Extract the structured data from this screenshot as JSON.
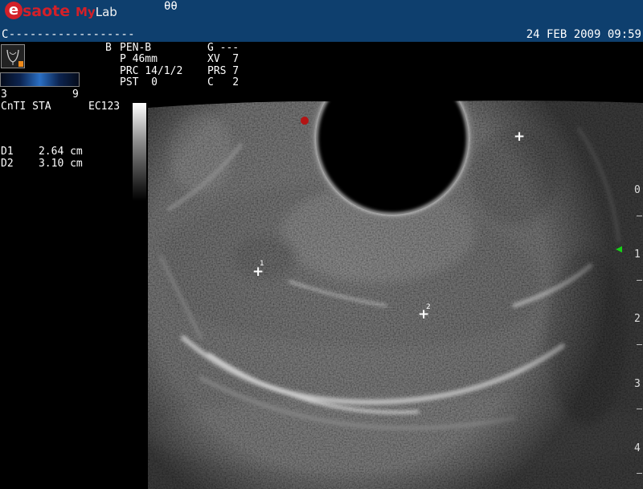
{
  "header": {
    "logo_e": "e",
    "logo_text": "saote",
    "logo_my": "My",
    "logo_lab": "Lab",
    "glyph": "θθ",
    "status_line": "C------------------",
    "date": "24 FEB 2009",
    "time": "09:59",
    "background_color": "#0e3f6e",
    "logo_color": "#d32029"
  },
  "params": {
    "mode": "B",
    "col1": [
      "PEN-B",
      "P 46mm",
      "PRC 14/1/2",
      "PST  0"
    ],
    "col2": [
      "G ---",
      "XV  7",
      "PRS 7",
      "C   2"
    ]
  },
  "left_panel": {
    "probe_icon": "uterus-icon",
    "map_min": "3",
    "map_max": "9",
    "info_line": "CnTI STA",
    "probe_name": "EC123"
  },
  "measurements": [
    {
      "label": "D1",
      "value": "2.64",
      "unit": "cm"
    },
    {
      "label": "D2",
      "value": "3.10",
      "unit": "cm"
    }
  ],
  "calipers": [
    {
      "number": "1"
    },
    {
      "number": "2"
    }
  ],
  "depth_scale": [
    "0",
    "1",
    "2",
    "3",
    "4"
  ],
  "colors": {
    "focus_marker": "#17d017",
    "doppler_dot": "#b31414"
  }
}
